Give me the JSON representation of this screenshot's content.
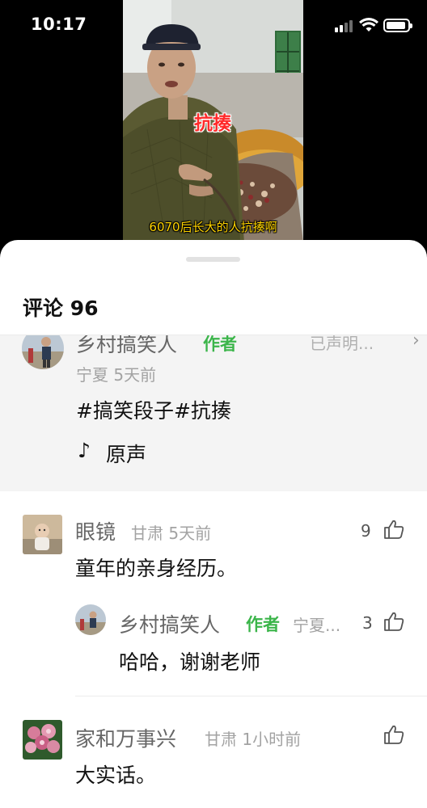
{
  "status_bar": {
    "time": "10:17",
    "battery_level": 0.9
  },
  "video": {
    "tag": "抗揍",
    "caption": "6070后长大的人抗揍啊"
  },
  "comments_panel": {
    "title": "评论 96",
    "author_post": {
      "name": "乡村搞笑人",
      "badge": "作者",
      "status": "已声明...",
      "meta": "宁夏 5天前",
      "text": "#搞笑段子#抗揍",
      "sound": "原声"
    },
    "comments": [
      {
        "name": "眼镜",
        "meta": "甘肃 5天前",
        "text": "童年的亲身经历。",
        "likes": "9"
      },
      {
        "name": "家和万事兴",
        "meta": "甘肃 1小时前",
        "text": "大实话。",
        "likes": ""
      }
    ],
    "reply": {
      "name": "乡村搞笑人",
      "badge": "作者",
      "meta": "宁夏...",
      "text": "哈哈，谢谢老师",
      "likes": "3"
    }
  },
  "colors": {
    "author_badge": "#3bb54a",
    "caption": "#ffd400",
    "tag": "#ff2a2a"
  }
}
